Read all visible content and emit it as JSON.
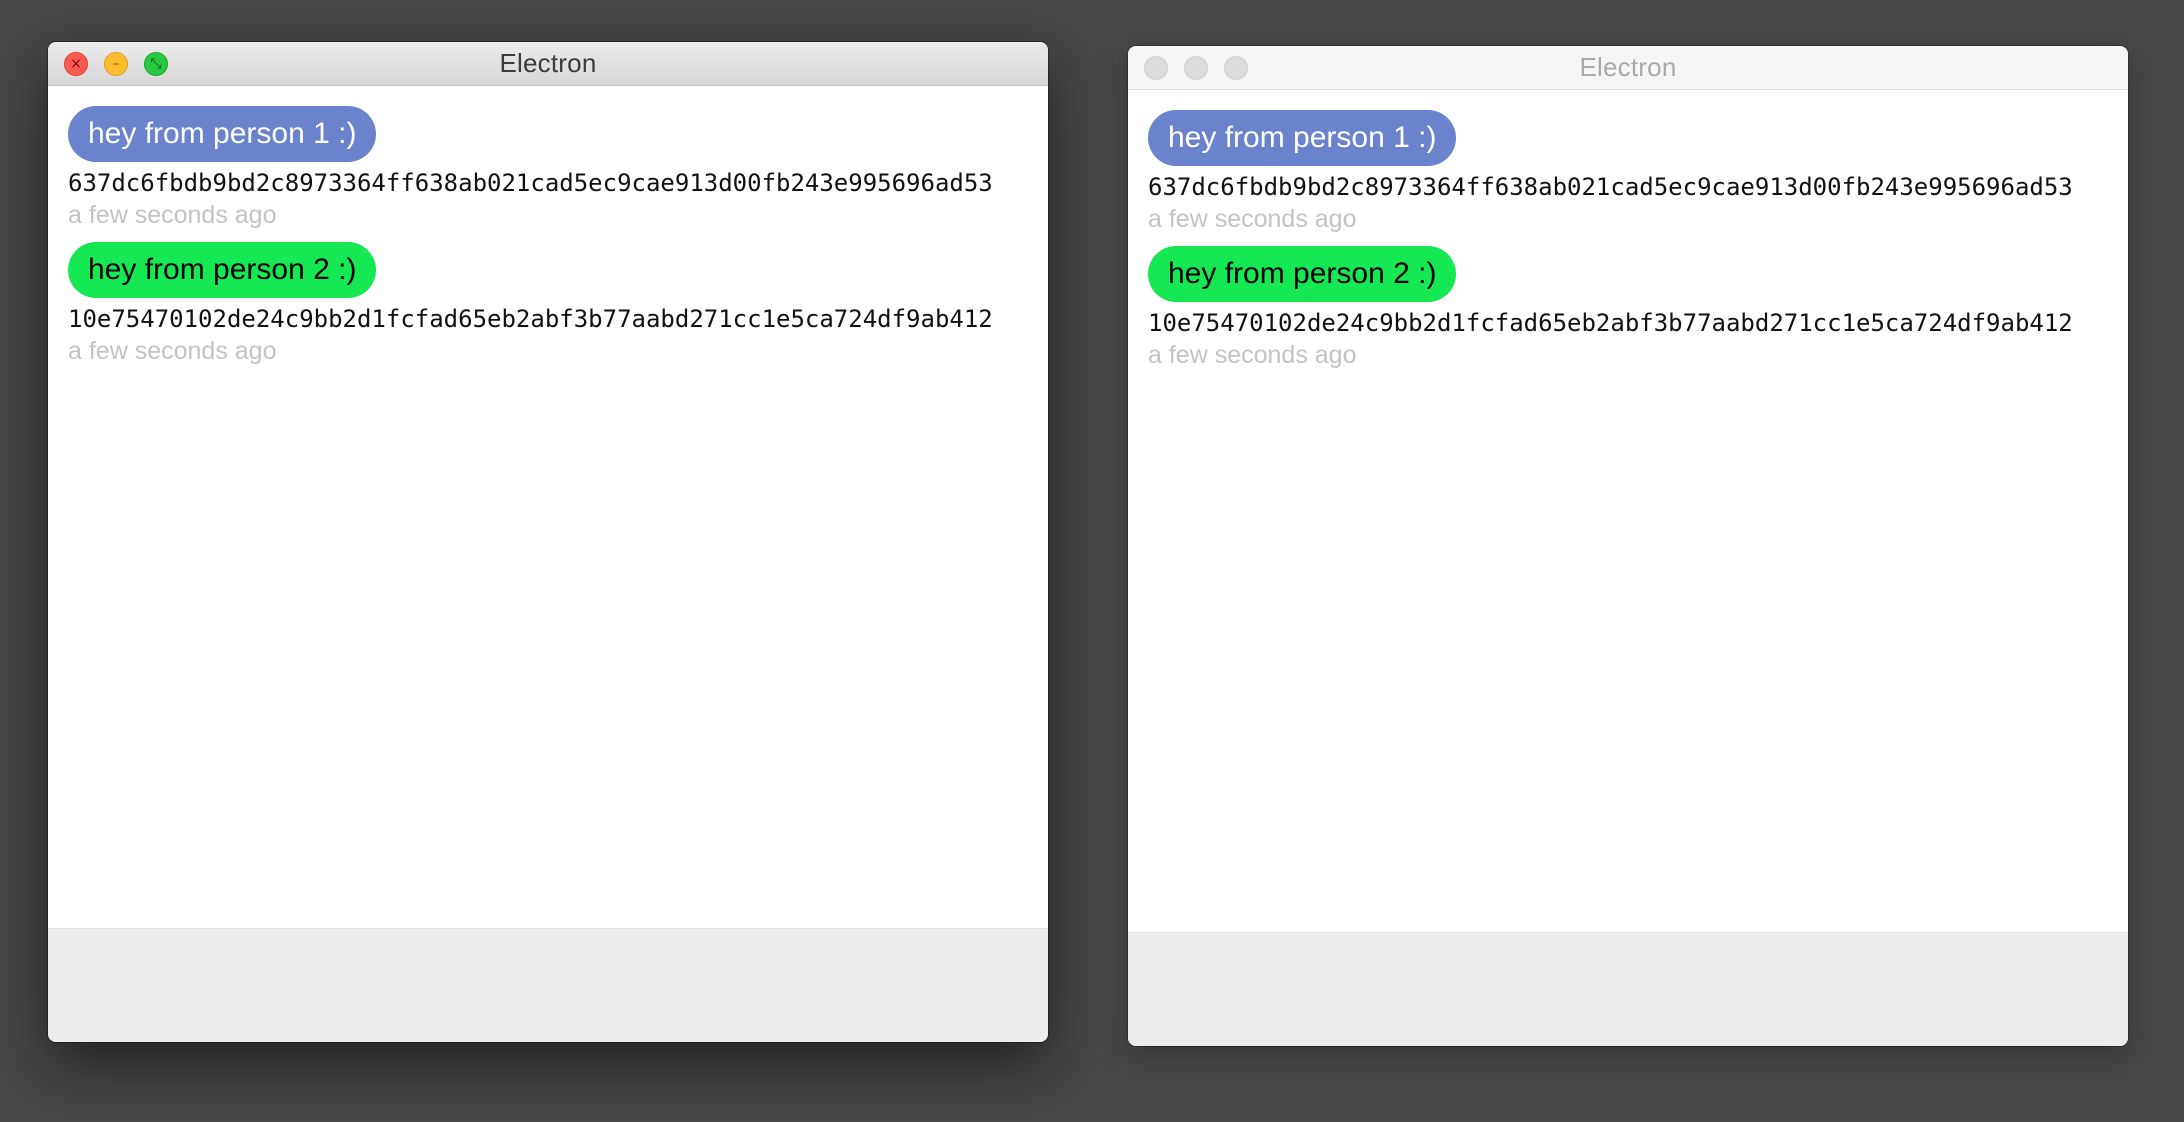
{
  "windows": [
    {
      "title": "Electron",
      "state": "active",
      "controls": {
        "close": "×",
        "minimize": "–",
        "zoom": "⤡"
      },
      "messages": [
        {
          "text": "hey from person 1 :)",
          "hash": "637dc6fbdb9bd2c8973364ff638ab021cad5ec9cae913d00fb243e995696ad53",
          "time": "a few seconds ago",
          "sender_color": "#6b82cc"
        },
        {
          "text": "hey from person 2 :)",
          "hash": "10e75470102de24c9bb2d1fcfad65eb2abf3b77aabd271cc1e5ca724df9ab412",
          "time": "a few seconds ago",
          "sender_color": "#15e852"
        }
      ]
    },
    {
      "title": "Electron",
      "state": "inactive",
      "messages": [
        {
          "text": "hey from person 1 :)",
          "hash": "637dc6fbdb9bd2c8973364ff638ab021cad5ec9cae913d00fb243e995696ad53",
          "time": "a few seconds ago",
          "sender_color": "#6b82cc"
        },
        {
          "text": "hey from person 2 :)",
          "hash": "10e75470102de24c9bb2d1fcfad65eb2abf3b77aabd271cc1e5ca724df9ab412",
          "time": "a few seconds ago",
          "sender_color": "#15e852"
        }
      ]
    }
  ],
  "colors": {
    "desktop": "#474747",
    "person1_bubble": "#6b82cc",
    "person2_bubble": "#15e852",
    "timestamp": "#c3c3c3",
    "footer": "#ededed"
  }
}
